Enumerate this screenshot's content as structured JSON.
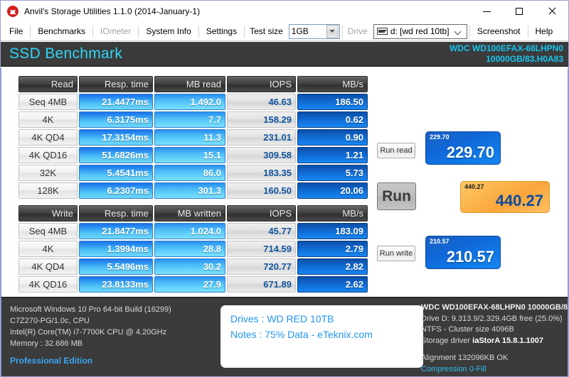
{
  "window": {
    "title": "Anvil's Storage Utilities 1.1.0 (2014-January-1)",
    "icon": "anvil-icon",
    "minimize_label": "",
    "maximize_label": "",
    "close_label": ""
  },
  "menubar": {
    "items": [
      {
        "label": "File",
        "disabled": false
      },
      {
        "label": "Benchmarks",
        "disabled": false
      },
      {
        "label": "IOmeter",
        "disabled": true
      },
      {
        "label": "System Info",
        "disabled": false
      },
      {
        "label": "Settings",
        "disabled": false
      }
    ],
    "test_size_label": "Test size",
    "test_size_value": "1GB",
    "drive_label": "Drive",
    "drive_value": "d: [wd red 10tb]",
    "screenshot_label": "Screenshot",
    "help_label": "Help"
  },
  "header": {
    "title": "SSD Benchmark",
    "drive_line1": "WDC WD100EFAX-68LHPN0",
    "drive_line2": "10000GB/83.H0A83",
    "accent_color": "#17c5f0"
  },
  "read_table": {
    "headers": [
      "Read",
      "Resp. time",
      "MB read",
      "IOPS",
      "MB/s"
    ],
    "rows": [
      {
        "label": "Seq 4MB",
        "resp": "21.4477ms",
        "mb": "1.492.0",
        "iops": "46.63",
        "mbs": "186.50"
      },
      {
        "label": "4K",
        "resp": "6.3175ms",
        "mb": "7.7",
        "iops": "158.29",
        "mbs": "0.62"
      },
      {
        "label": "4K QD4",
        "resp": "17.3154ms",
        "mb": "11.3",
        "iops": "231.01",
        "mbs": "0.90"
      },
      {
        "label": "4K QD16",
        "resp": "51.6826ms",
        "mb": "15.1",
        "iops": "309.58",
        "mbs": "1.21"
      },
      {
        "label": "32K",
        "resp": "5.4541ms",
        "mb": "86.0",
        "iops": "183.35",
        "mbs": "5.73"
      },
      {
        "label": "128K",
        "resp": "6.2307ms",
        "mb": "301.3",
        "iops": "160.50",
        "mbs": "20.06"
      }
    ]
  },
  "write_table": {
    "headers": [
      "Write",
      "Resp. time",
      "MB written",
      "IOPS",
      "MB/s"
    ],
    "rows": [
      {
        "label": "Seq 4MB",
        "resp": "21.8477ms",
        "mb": "1.024.0",
        "iops": "45.77",
        "mbs": "183.09"
      },
      {
        "label": "4K",
        "resp": "1.3994ms",
        "mb": "28.8",
        "iops": "714.59",
        "mbs": "2.79"
      },
      {
        "label": "4K QD4",
        "resp": "5.5496ms",
        "mb": "30.2",
        "iops": "720.77",
        "mbs": "2.82"
      },
      {
        "label": "4K QD16",
        "resp": "23.8133ms",
        "mb": "27.9",
        "iops": "671.89",
        "mbs": "2.62"
      }
    ]
  },
  "controls": {
    "run_read_label": "Run read",
    "run_label": "Run",
    "run_write_label": "Run write",
    "read_score_small": "229.70",
    "read_score": "229.70",
    "total_score_small": "440.27",
    "total_score": "440.27",
    "write_score_small": "210.57",
    "write_score": "210.57",
    "read_score_color": "#1068d8",
    "total_score_color": "#f9a63c",
    "write_score_color": "#1068d8"
  },
  "sysinfo": {
    "os": "Microsoft Windows 10 Pro 64-bit Build (16299)",
    "board": "C7Z270-PG/1.0c, CPU",
    "cpu": "Intel(R) Core(TM) i7-7700K CPU @ 4.20GHz",
    "memory": "Memory : 32.686 MB",
    "edition": "Professional Edition"
  },
  "notes": {
    "drives": "Drives : WD RED 10TB",
    "notes": "Notes : 75% Data - eTeknix.com"
  },
  "driveinfo": {
    "model": "WDC WD100EFAX-68LHPN0 10000GB/8",
    "capacity": "Drive D: 9.313.9/2.329.4GB free (25.0%)",
    "filesystem": "NTFS - Cluster size 4096B",
    "storage_driver_label": "Storage driver",
    "storage_driver_value": "iaStorA 15.8.1.1007",
    "alignment": "Alignment 132096KB OK",
    "compression": "Compression 0-Fill"
  }
}
